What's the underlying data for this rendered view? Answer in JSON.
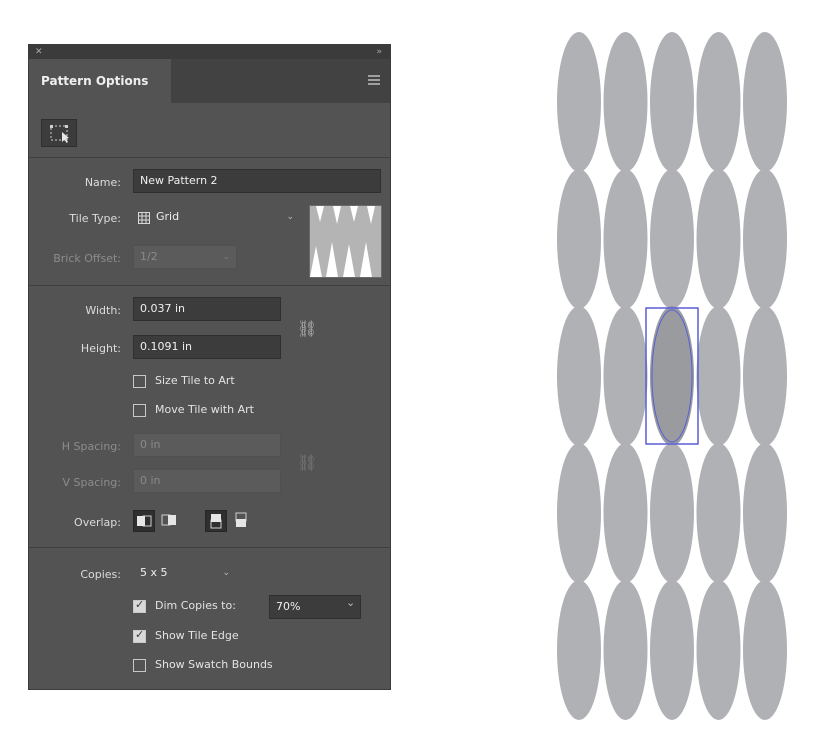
{
  "panel": {
    "title": "Pattern Options",
    "name_label": "Name:",
    "name_value": "New Pattern 2",
    "tile_type_label": "Tile Type:",
    "tile_type_value": "Grid",
    "brick_offset_label": "Brick Offset:",
    "brick_offset_value": "1/2",
    "width_label": "Width:",
    "width_value": "0.037 in",
    "height_label": "Height:",
    "height_value": "0.1091 in",
    "size_tile_label": "Size Tile to Art",
    "size_tile_checked": false,
    "move_tile_label": "Move Tile with Art",
    "move_tile_checked": false,
    "h_spacing_label": "H Spacing:",
    "h_spacing_value": "0 in",
    "v_spacing_label": "V Spacing:",
    "v_spacing_value": "0 in",
    "overlap_label": "Overlap:",
    "copies_label": "Copies:",
    "copies_value": "5 x 5",
    "dim_copies_label": "Dim Copies to:",
    "dim_copies_checked": true,
    "dim_copies_value": "70%",
    "show_tile_edge_label": "Show Tile Edge",
    "show_tile_edge_checked": true,
    "show_swatch_bounds_label": "Show Swatch Bounds",
    "show_swatch_bounds_checked": false
  },
  "canvas": {
    "rows": 5,
    "cols": 5,
    "copy_color": "#b0b1b5",
    "selected_color": "#9a9b9f",
    "selection_color": "#5a5fd6"
  },
  "colors": {
    "panel_bg": "#535353",
    "field_bg": "#3c3c3c"
  }
}
